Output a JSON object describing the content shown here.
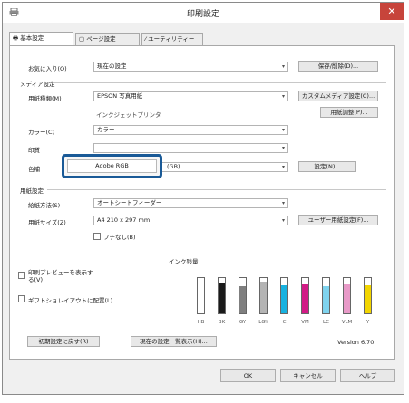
{
  "window": {
    "title": "印刷設定",
    "close_glyph": "✕"
  },
  "tabs": [
    {
      "icon": "printer-icon",
      "label": "基本設定"
    },
    {
      "icon": "page-icon",
      "label": "ページ設定"
    },
    {
      "icon": "wrench-icon",
      "label": "ユーティリティー"
    }
  ],
  "favorites": {
    "label": "お気に入り(O)",
    "value": "現在の設定",
    "button": "保存/削除(D)..."
  },
  "media": {
    "group_label": "メディア設定",
    "paper_type_label": "用紙種類(M)",
    "paper_type_value": "EPSON 写真用紙",
    "custom_media_button": "カスタムメディア設定(C)...",
    "ink_note": "インクジェットプリンタ",
    "paper_adjust_button": "用紙調整(P)...",
    "color_label": "カラー(C)",
    "color_value": "カラー",
    "quality_label": "印質",
    "color_mode_label": "色補",
    "color_mode_value": "(GB)",
    "settings_button": "設定(N)..."
  },
  "popup": {
    "label": "Adobe RGB"
  },
  "paper": {
    "group_label": "用紙設定",
    "source_label": "給紙方法(S)",
    "source_value": "オートシートフィーダー",
    "size_label": "用紙サイズ(Z)",
    "size_value": "A4 210 x 297 mm",
    "user_size_button": "ユーザー用紙設定(F)...",
    "borderless_label": "フチなし(B)"
  },
  "options": {
    "preview_label": "印刷プレビューを表示する(V)",
    "layout_label": "ギフトショレイアウトに配置(L)"
  },
  "ink": {
    "label": "インク残量",
    "levels": [
      {
        "name": "HB",
        "color": "#c8c8c8",
        "level": 0
      },
      {
        "name": "BK",
        "color": "#1a1a1a",
        "level": 0.85
      },
      {
        "name": "GY",
        "color": "#7f7f7f",
        "level": 0.78
      },
      {
        "name": "LGY",
        "color": "#b4b4b4",
        "level": 0.9
      },
      {
        "name": "C",
        "color": "#18b2e0",
        "level": 0.8
      },
      {
        "name": "VM",
        "color": "#d21b86",
        "level": 0.82
      },
      {
        "name": "LC",
        "color": "#7fd3ee",
        "level": 0.78
      },
      {
        "name": "VLM",
        "color": "#e89ac8",
        "level": 0.82
      },
      {
        "name": "Y",
        "color": "#f2d500",
        "level": 0.8
      }
    ]
  },
  "footer": {
    "reset_button": "初期設定に戻す(R)",
    "current_list_button": "現在の設定一覧表示(H)...",
    "version": "Version 6.70"
  },
  "dialog_buttons": {
    "ok": "OK",
    "cancel": "キャンセル",
    "help": "ヘルプ"
  }
}
